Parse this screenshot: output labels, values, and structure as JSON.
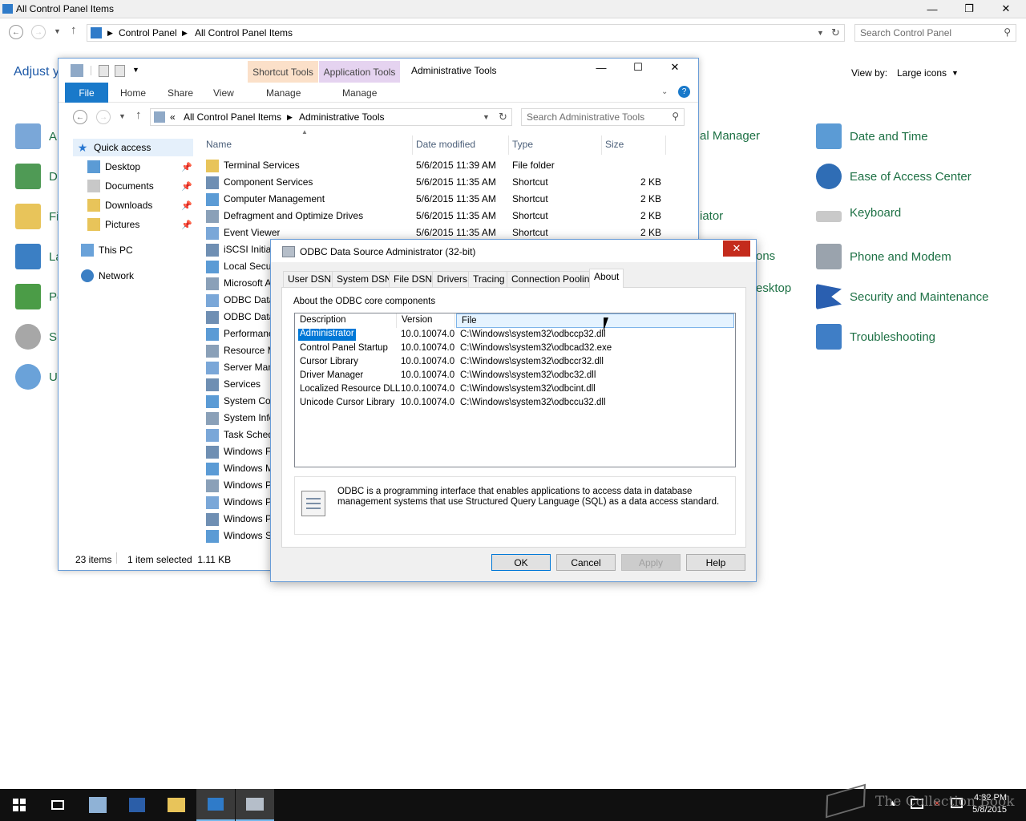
{
  "control_panel": {
    "title": "All Control Panel Items",
    "breadcrumb": [
      "Control Panel",
      "All Control Panel Items"
    ],
    "search_placeholder": "Search Control Panel",
    "heading_partial": "Adjust y",
    "view_by_label": "View by:",
    "view_by_value": "Large icons",
    "left_col_partial": [
      "A",
      "D",
      "Fi",
      "La",
      "Pe",
      "S",
      "U"
    ],
    "mid_col_partial": [
      "al Manager",
      "iator",
      "ons",
      "esktop"
    ],
    "right_items": [
      "Date and Time",
      "Ease of Access Center",
      "Keyboard",
      "Phone and Modem",
      "Security and Maintenance",
      "Troubleshooting"
    ]
  },
  "explorer": {
    "title": "Administrative Tools",
    "context_tabs": [
      "Shortcut Tools",
      "Application Tools"
    ],
    "ribbon_tabs": [
      "File",
      "Home",
      "Share",
      "View",
      "Manage",
      "Manage"
    ],
    "breadcrumb": [
      "All Control Panel Items",
      "Administrative Tools"
    ],
    "search_placeholder": "Search Administrative Tools",
    "nav": {
      "quick_access": "Quick access",
      "pinned": [
        "Desktop",
        "Documents",
        "Downloads",
        "Pictures"
      ],
      "this_pc": "This PC",
      "network": "Network"
    },
    "columns": [
      "Name",
      "Date modified",
      "Type",
      "Size"
    ],
    "files": [
      {
        "name": "Terminal Services",
        "date": "5/6/2015 11:39 AM",
        "type": "File folder",
        "size": ""
      },
      {
        "name": "Component Services",
        "date": "5/6/2015 11:35 AM",
        "type": "Shortcut",
        "size": "2 KB"
      },
      {
        "name": "Computer Management",
        "date": "5/6/2015 11:35 AM",
        "type": "Shortcut",
        "size": "2 KB"
      },
      {
        "name": "Defragment and Optimize Drives",
        "date": "5/6/2015 11:35 AM",
        "type": "Shortcut",
        "size": "2 KB"
      },
      {
        "name": "Event Viewer",
        "date": "5/6/2015 11:35 AM",
        "type": "Shortcut",
        "size": "2 KB"
      },
      {
        "name": "iSCSI Initiat",
        "date": "",
        "type": "",
        "size": ""
      },
      {
        "name": "Local Secur",
        "date": "",
        "type": "",
        "size": ""
      },
      {
        "name": "Microsoft A",
        "date": "",
        "type": "",
        "size": ""
      },
      {
        "name": "ODBC Data",
        "date": "",
        "type": "",
        "size": ""
      },
      {
        "name": "ODBC Data",
        "date": "",
        "type": "",
        "size": ""
      },
      {
        "name": "Performanc",
        "date": "",
        "type": "",
        "size": ""
      },
      {
        "name": "Resource M",
        "date": "",
        "type": "",
        "size": ""
      },
      {
        "name": "Server Man",
        "date": "",
        "type": "",
        "size": ""
      },
      {
        "name": "Services",
        "date": "",
        "type": "",
        "size": ""
      },
      {
        "name": "System Con",
        "date": "",
        "type": "",
        "size": ""
      },
      {
        "name": "System Infc",
        "date": "",
        "type": "",
        "size": ""
      },
      {
        "name": "Task Sched",
        "date": "",
        "type": "",
        "size": ""
      },
      {
        "name": "Windows F",
        "date": "",
        "type": "",
        "size": ""
      },
      {
        "name": "Windows M",
        "date": "",
        "type": "",
        "size": ""
      },
      {
        "name": "Windows P",
        "date": "",
        "type": "",
        "size": ""
      },
      {
        "name": "Windows P",
        "date": "",
        "type": "",
        "size": ""
      },
      {
        "name": "Windows P",
        "date": "",
        "type": "",
        "size": ""
      },
      {
        "name": "Windows S",
        "date": "",
        "type": "",
        "size": ""
      }
    ],
    "status_count": "23 items",
    "status_selected": "1 item selected  1.11 KB"
  },
  "odbc": {
    "title": "ODBC Data Source Administrator (32-bit)",
    "tabs": [
      "User DSN",
      "System DSN",
      "File DSN",
      "Drivers",
      "Tracing",
      "Connection Pooling",
      "About"
    ],
    "section_label": "About the ODBC core components",
    "columns": [
      "Description",
      "Version",
      "File"
    ],
    "components": [
      {
        "description": "Administrator",
        "version": "10.0.10074.0",
        "file": "C:\\Windows\\system32\\odbccp32.dll"
      },
      {
        "description": "Control Panel Startup",
        "version": "10.0.10074.0",
        "file": "C:\\Windows\\system32\\odbcad32.exe"
      },
      {
        "description": "Cursor Library",
        "version": "10.0.10074.0",
        "file": "C:\\Windows\\system32\\odbccr32.dll"
      },
      {
        "description": "Driver Manager",
        "version": "10.0.10074.0",
        "file": "C:\\Windows\\system32\\odbc32.dll"
      },
      {
        "description": "Localized Resource DLL",
        "version": "10.0.10074.0",
        "file": "C:\\Windows\\system32\\odbcint.dll"
      },
      {
        "description": "Unicode Cursor Library",
        "version": "10.0.10074.0",
        "file": "C:\\Windows\\system32\\odbccu32.dll"
      }
    ],
    "info_text": "ODBC is a programming interface that enables applications to access data in database management systems that use Structured Query Language (SQL) as a data access standard.",
    "buttons": {
      "ok": "OK",
      "cancel": "Cancel",
      "apply": "Apply",
      "help": "Help"
    }
  },
  "taskbar": {
    "time": "4:32 PM",
    "date": "5/8/2015",
    "watermark": "The Collection Book"
  },
  "colors": {
    "accent": "#1979ca",
    "cp_link": "#1e7145",
    "selection": "#0078d7",
    "taskbar": "#101010"
  }
}
